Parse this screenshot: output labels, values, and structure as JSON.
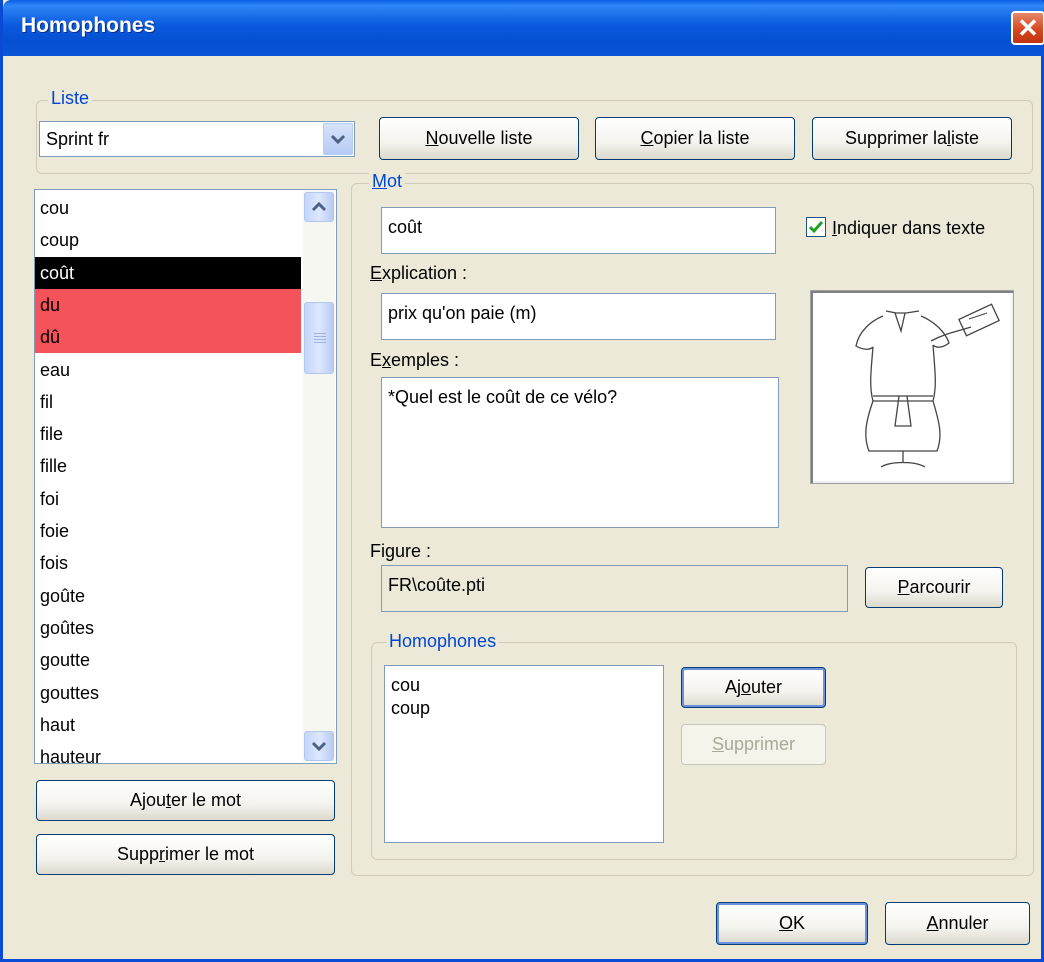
{
  "window": {
    "title": "Homophones",
    "close_glyph": "✕"
  },
  "liste": {
    "legend": "Liste",
    "selected": "Sprint fr",
    "buttons": {
      "nouvelle": {
        "pre": "",
        "ul": "N",
        "post": "ouvelle liste"
      },
      "copier": {
        "pre": "",
        "ul": "C",
        "post": "opier la liste"
      },
      "supprimer": {
        "pre": "Supprimer la ",
        "ul": "l",
        "post": "iste"
      }
    }
  },
  "words": {
    "items": [
      "cou",
      "coup",
      "coût",
      "du",
      "dû",
      "eau",
      "fil",
      "file",
      "fille",
      "foi",
      "foie",
      "fois",
      "goûte",
      "goûtes",
      "goutte",
      "gouttes",
      "haut",
      "hauteur"
    ],
    "selected_index": 2,
    "homophone_indices": [
      3,
      4
    ],
    "add_button": {
      "pre": "Ajou",
      "ul": "t",
      "post": "er le mot"
    },
    "delete_button": {
      "pre": "Supp",
      "ul": "r",
      "post": "imer le mot"
    }
  },
  "mot": {
    "legend_ul": "M",
    "legend_rest": "ot",
    "value": "coût",
    "checkbox": {
      "ul": "I",
      "rest": "ndiquer dans texte",
      "checked": true
    },
    "explication_label": {
      "ul": "E",
      "rest": "xplication :"
    },
    "explication_value": "prix qu'on paie (m)",
    "exemples_label": {
      "pre": "E",
      "ul": "x",
      "rest": "emples :"
    },
    "exemples_value": "*Quel est le coût de ce vélo?",
    "figure_label": "Figure :",
    "figure_value": "FR\\coûte.pti",
    "parcourir": {
      "ul": "P",
      "rest": "arcourir"
    },
    "picture_icon": "dress-on-mannequin-icon"
  },
  "homophones": {
    "legend": "Homophones",
    "items": [
      "cou",
      "coup"
    ],
    "ajouter": {
      "pre": "Aj",
      "ul": "o",
      "post": "uter"
    },
    "supprimer": {
      "ul": "S",
      "post": "upprimer"
    }
  },
  "footer": {
    "ok": {
      "ul": "O",
      "post": "K"
    },
    "annuler": {
      "ul": "A",
      "post": "nnuler"
    }
  }
}
